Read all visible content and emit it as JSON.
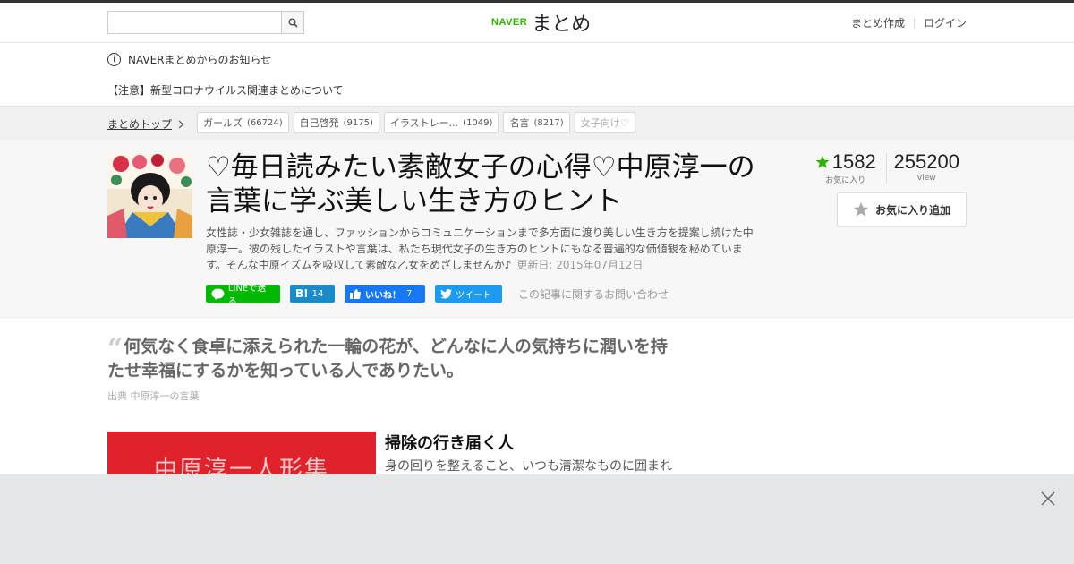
{
  "header": {
    "search_placeholder": "",
    "logo_naver": "NAVER",
    "logo_matome": "まとめ",
    "links": [
      "まとめ作成",
      "ログイン"
    ]
  },
  "notice": {
    "info_icon": "i",
    "title": "NAVERまとめからのお知らせ",
    "item": "【注意】新型コロナウイルス関連まとめについて"
  },
  "breadcrumb": {
    "top": "まとめトップ",
    "tags": [
      {
        "label": "ガールズ",
        "count": "(66724)"
      },
      {
        "label": "自己啓発",
        "count": "(9175)"
      },
      {
        "label": "イラストレー...",
        "count": "(1049)"
      },
      {
        "label": "名言",
        "count": "(8217)"
      },
      {
        "label": "女子向け♡",
        "count": ""
      }
    ]
  },
  "article": {
    "title": "♡毎日読みたい素敵女子の心得♡中原淳一の言葉に学ぶ美しい生き方のヒント",
    "description": "女性誌・少女雑誌を通し、ファッションからコミュニケーションまで多方面に渡り美しい生き方を提案し続けた中原淳一。彼の残したイラストや言葉は、私たち現代女子の生き方のヒントにもなる普遍的な価値観を秘めています。そんな中原イズムを吸収して素敵な乙女をめざしませんか♪",
    "updated": "更新日: 2015年07月12日",
    "share": {
      "line": "LINEで送る",
      "hatena_mark": "B!",
      "hatena_count": "14",
      "fb_like": "いいね！",
      "fb_count": "7",
      "tweet": "ツイート",
      "contact": "この記事に関するお問い合わせ"
    },
    "stats": {
      "favorites": "1582",
      "favorites_label": "お気に入り",
      "views": "255200",
      "views_label": "view"
    },
    "fav_button": "お気に入り追加"
  },
  "quote": {
    "text": "何気なく食卓に添えられた一輪の花が、どんなに人の気持ちに潤いを持たせ幸福にするかを知っている人でありたい。",
    "source": "出典  中原淳一の言葉"
  },
  "item": {
    "image_text": "中原淳一人形集",
    "title": "掃除の行き届く人",
    "text": "身の回りを整えること、いつも清潔なものに囲まれ"
  },
  "colors": {
    "naver_green": "#2db400",
    "star_green": "#2db400",
    "line_green": "#00b900",
    "hatena_blue": "#1b8ac9",
    "fb_blue": "#1877f2",
    "twitter_blue": "#1d9bf0",
    "ad_bg": "#e5e6e8"
  }
}
